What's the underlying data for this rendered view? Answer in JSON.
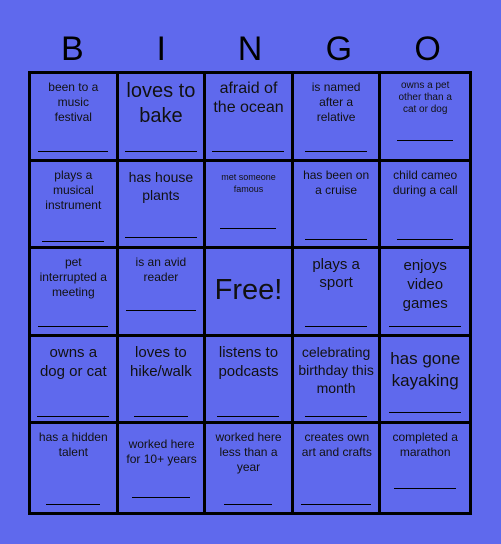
{
  "header": {
    "letters": [
      "B",
      "I",
      "N",
      "G",
      "O"
    ]
  },
  "colors": {
    "background": "#5f69ed",
    "grid_lines": "#000000"
  },
  "cells": [
    [
      "been to a music festival",
      "loves to bake",
      "afraid of the ocean",
      "is named after a relative",
      "owns a pet other than a cat or dog"
    ],
    [
      "plays a musical instrument",
      "has house plants",
      "met someone famous",
      "has been on a cruise",
      "child cameo during a call"
    ],
    [
      "pet interrupted a meeting",
      "is an avid reader",
      "Free!",
      "plays a sport",
      "enjoys video games"
    ],
    [
      "owns a dog or cat",
      "loves to hike/walk",
      "listens to podcasts",
      "celebrating birthday this month",
      "has gone kayaking"
    ],
    [
      "has a hidden talent",
      "worked here for 10+ years",
      "worked here less than a year",
      "creates own art and crafts",
      "completed a marathon"
    ]
  ]
}
